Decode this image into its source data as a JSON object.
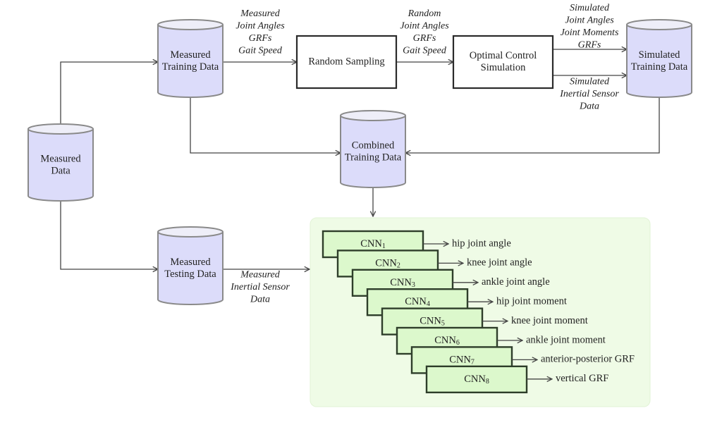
{
  "nodes": {
    "measured_data": {
      "lines": [
        "Measured",
        "Data"
      ]
    },
    "measured_training": {
      "lines": [
        "Measured",
        "Training Data"
      ]
    },
    "random_sampling": {
      "lines": [
        "Random Sampling"
      ]
    },
    "optimal_control": {
      "lines": [
        "Optimal Control",
        "Simulation"
      ]
    },
    "simulated_training": {
      "lines": [
        "Simulated",
        "Training Data"
      ]
    },
    "combined_training": {
      "lines": [
        "Combined",
        "Training Data"
      ]
    },
    "measured_testing": {
      "lines": [
        "Measured",
        "Testing Data"
      ]
    }
  },
  "edge_labels": {
    "measured_to_sampling": [
      "Measured",
      "Joint Angles",
      "GRFs",
      "Gait Speed"
    ],
    "sampling_to_ocs": [
      "Random",
      "Joint Angles",
      "GRFs",
      "Gait Speed"
    ],
    "ocs_to_sim_upper": [
      "Simulated",
      "Joint Angles",
      "Joint Moments",
      "GRFs"
    ],
    "ocs_to_sim_lower": [
      "Simulated",
      "Inertial Sensor",
      "Data"
    ],
    "testing_to_cnn": [
      "Measured",
      "Inertial Sensor",
      "Data"
    ]
  },
  "cnns": [
    {
      "name": "CNN",
      "sub": "1",
      "output": "hip joint angle"
    },
    {
      "name": "CNN",
      "sub": "2",
      "output": "knee joint angle"
    },
    {
      "name": "CNN",
      "sub": "3",
      "output": "ankle joint angle"
    },
    {
      "name": "CNN",
      "sub": "4",
      "output": "hip joint moment"
    },
    {
      "name": "CNN",
      "sub": "5",
      "output": "knee joint moment"
    },
    {
      "name": "CNN",
      "sub": "6",
      "output": "ankle joint moment"
    },
    {
      "name": "CNN",
      "sub": "7",
      "output": "anterior-posterior GRF"
    },
    {
      "name": "CNN",
      "sub": "8",
      "output": "vertical GRF"
    }
  ],
  "colors": {
    "cylinder_fill": "#dcdcfa",
    "cylinder_top": "#eeeef8",
    "panel_fill": "#effbe6",
    "cnn_fill": "#dcf8cc"
  }
}
